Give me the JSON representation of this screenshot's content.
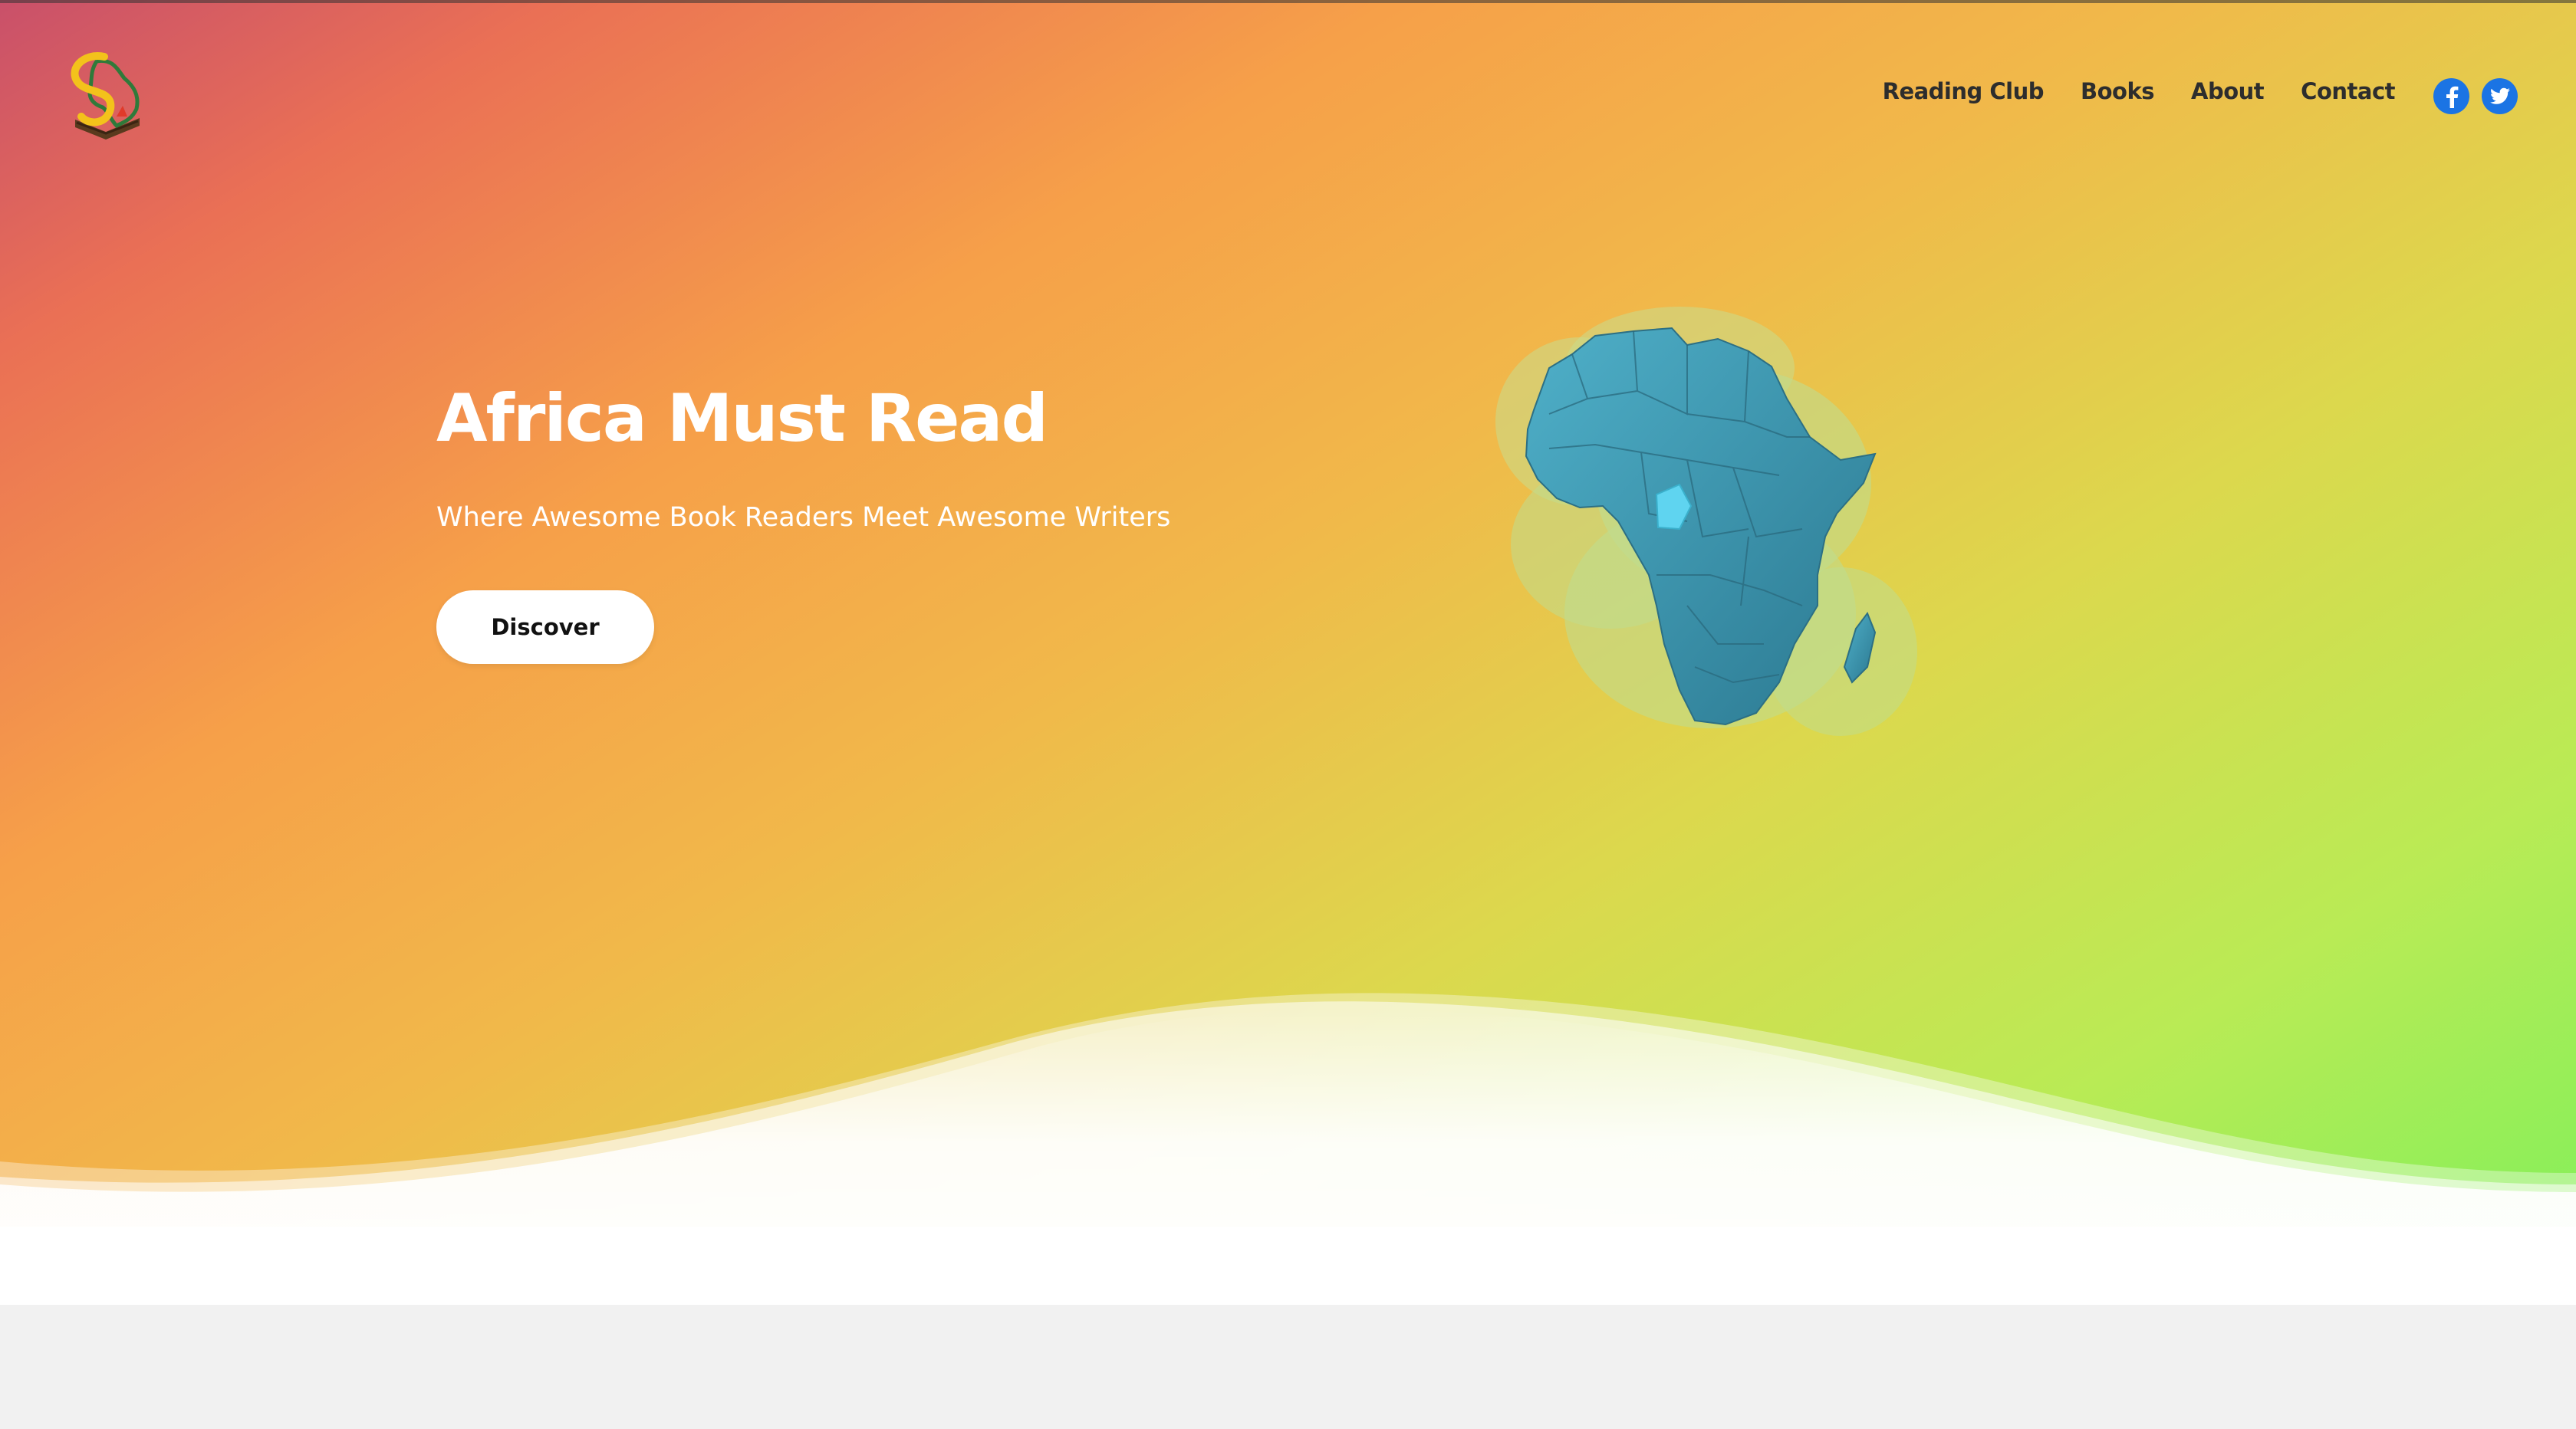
{
  "brand": {
    "logo_icon": "africa-book-logo-icon"
  },
  "nav": {
    "items": [
      {
        "label": "Reading Club"
      },
      {
        "label": "Books"
      },
      {
        "label": "About"
      },
      {
        "label": "Contact"
      }
    ],
    "social": [
      {
        "icon": "facebook-icon"
      },
      {
        "icon": "twitter-icon"
      }
    ]
  },
  "hero": {
    "title": "Africa Must Read",
    "subtitle": "Where Awesome Book Readers Meet Awesome Writers",
    "cta_label": "Discover",
    "illustration_icon": "africa-map-icon"
  },
  "colors": {
    "gradient_start": "#c9506a",
    "gradient_mid": "#f6a049",
    "gradient_end": "#7ef05b",
    "social": "#1b74e4",
    "map": "#3e9bb6",
    "map_highlight": "#5fd4f0",
    "footer_band": "#f1f1f1"
  }
}
